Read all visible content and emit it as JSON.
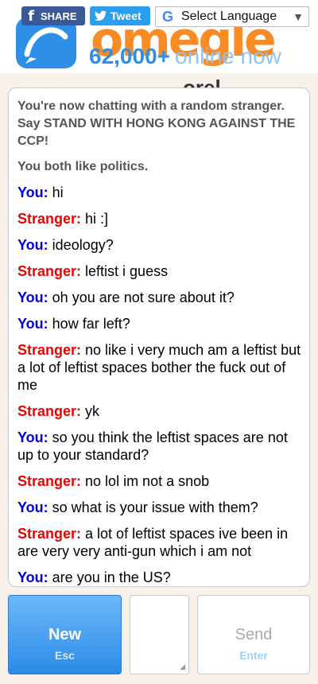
{
  "share": {
    "facebook_label": "SHARE",
    "facebook_icon": "f",
    "twitter_label": "Tweet",
    "language_label": "Select Language",
    "language_icon": "G",
    "language_arrow": "▼"
  },
  "header": {
    "logo_text": "omegle",
    "online_count": "62,000+",
    "online_suffix": "online now",
    "partial_heading": "orel"
  },
  "chat": {
    "system": [
      "You're now chatting with a random stranger. Say STAND WITH HONG KONG AGAINST THE CCP!",
      "You both like politics."
    ],
    "messages": [
      {
        "who": "You:",
        "text": "hi"
      },
      {
        "who": "Stranger:",
        "text": "hi :]"
      },
      {
        "who": "You:",
        "text": "ideology?"
      },
      {
        "who": "Stranger:",
        "text": "leftist i guess"
      },
      {
        "who": "You:",
        "text": "oh you are not sure about it?"
      },
      {
        "who": "You:",
        "text": "how far left?"
      },
      {
        "who": "Stranger:",
        "text": "no like i very much am a leftist but a lot of leftist spaces bother the fuck out of me"
      },
      {
        "who": "Stranger:",
        "text": "yk"
      },
      {
        "who": "You:",
        "text": "so you think the leftist spaces are not up to your standard?"
      },
      {
        "who": "Stranger:",
        "text": "no lol im not a snob"
      },
      {
        "who": "You:",
        "text": "so what is your issue with them?"
      },
      {
        "who": "Stranger:",
        "text": "a lot of leftist spaces ive been in are very very anti-gun which i am not"
      },
      {
        "who": "You:",
        "text": "are you in the US?"
      }
    ]
  },
  "controls": {
    "new_label": "New",
    "new_hint": "Esc",
    "send_label": "Send",
    "send_hint": "Enter",
    "message_value": ""
  },
  "colors": {
    "you": "#0000dd",
    "stranger": "#ee0000",
    "brand_blue": "#2e8fe8",
    "brand_orange": "#f88b23"
  }
}
